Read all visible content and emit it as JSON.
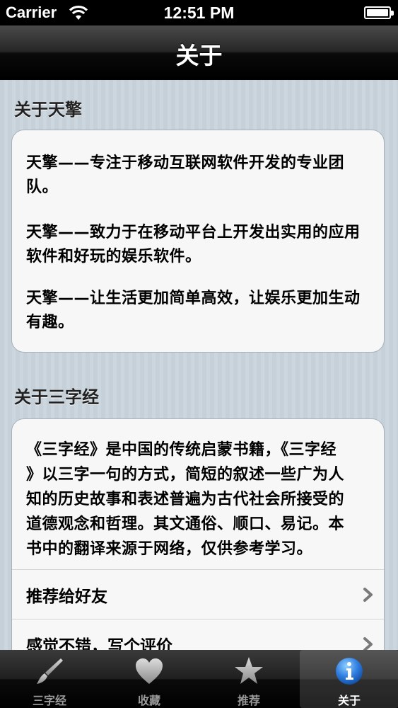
{
  "status_bar": {
    "carrier": "Carrier",
    "time": "12:51 PM"
  },
  "nav": {
    "title": "关于"
  },
  "section_about_tianqing": {
    "header": "关于天擎",
    "paragraphs": [
      "天擎——专注于移动互联网软件开发的专业团队。",
      "天擎——致力于在移动平台上开发出实用的应用软件和好玩的娱乐软件。",
      "天擎——让生活更加简单高效，让娱乐更加生动有趣。"
    ]
  },
  "section_about_sanzijing": {
    "header": "关于三字经",
    "description_lines": [
      "《三字经》是中国的传统启蒙书籍，《三字经",
      "》以三字一句的方式，简短的叙述一些广为人",
      "知的历史故事和表述普遍为古代社会所接受的",
      "道德观念和哲理。其文通俗、顺口、易记。本",
      "书中的翻译来源于网络，仅供参考学习。"
    ],
    "rows": [
      {
        "label": "推荐给好友"
      },
      {
        "label": "感觉不错，写个评价"
      }
    ]
  },
  "tabs": [
    {
      "label": "三字经",
      "icon": "brush-icon",
      "selected": false
    },
    {
      "label": "收藏",
      "icon": "heart-icon",
      "selected": false
    },
    {
      "label": "推荐",
      "icon": "star-icon",
      "selected": false
    },
    {
      "label": "关于",
      "icon": "info-icon",
      "selected": true
    }
  ],
  "colors": {
    "tab_active_label": "#ffffff",
    "tab_inactive_label": "#9a9a9a",
    "info_icon_blue": "#2f7de0"
  }
}
